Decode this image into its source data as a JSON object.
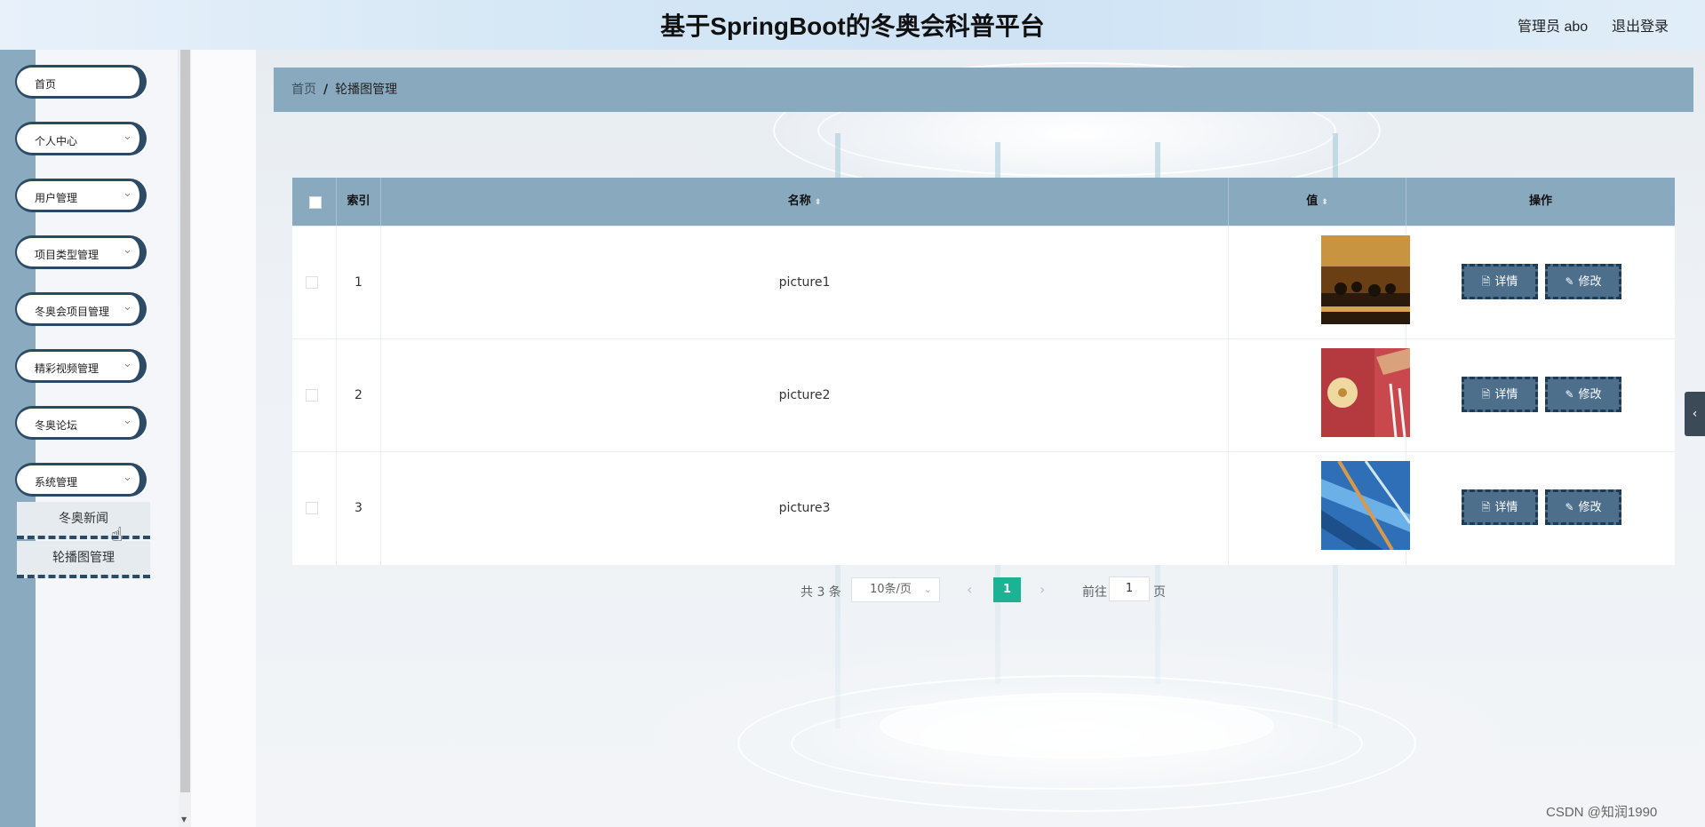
{
  "header": {
    "title": "基于SpringBoot的冬奥会科普平台",
    "user": "管理员 abo",
    "logout": "退出登录"
  },
  "sidebar": {
    "items": [
      {
        "label": "首页",
        "icon": ""
      },
      {
        "label": "个人中心",
        "icon": "chevron-down-icon"
      },
      {
        "label": "用户管理",
        "icon": "chevron-down-icon"
      },
      {
        "label": "项目类型管理",
        "icon": "chevron-down-icon"
      },
      {
        "label": "冬奥会项目管理",
        "icon": "chevron-down-icon"
      },
      {
        "label": "精彩视频管理",
        "icon": "chevron-down-icon"
      },
      {
        "label": "冬奥论坛",
        "icon": "chevron-down-icon"
      },
      {
        "label": "系统管理",
        "icon": "chevron-down-icon"
      }
    ],
    "submenu": [
      "冬奥新闻",
      "轮播图管理"
    ]
  },
  "breadcrumb": {
    "home": "首页",
    "separator": "/",
    "current": "轮播图管理"
  },
  "table": {
    "columns": [
      "索引",
      "名称",
      "值",
      "操作"
    ],
    "rows": [
      {
        "index": "1",
        "name": "picture1",
        "image": "dark-orange-sports-scene"
      },
      {
        "index": "2",
        "name": "picture2",
        "image": "red-table-tennis-scene"
      },
      {
        "index": "3",
        "name": "picture3",
        "image": "blue-swimming-scene"
      }
    ],
    "actions": {
      "detail": "详情",
      "edit": "修改"
    }
  },
  "pagination": {
    "total": "共 3 条",
    "page_size": "10条/页",
    "current_page": "1",
    "goto_prefix": "前往",
    "goto_value": "1",
    "goto_suffix": "页"
  },
  "side_tab_icon": "chevron-left-icon",
  "watermark": "CSDN @知润1990",
  "colors": {
    "header_bg": "#d6e8f6",
    "sidebar_strip": "#8aaabf",
    "menu_border": "#2b4a66",
    "table_header": "#89aabe",
    "button_bg": "#4d6f8c",
    "active_page": "#1bb394"
  }
}
